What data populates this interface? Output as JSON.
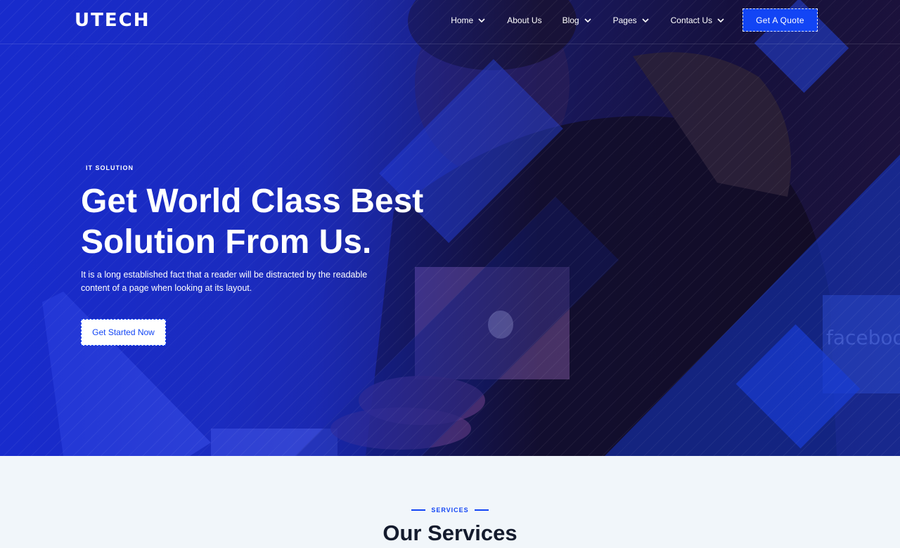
{
  "brand": {
    "logo_text": "UTECH"
  },
  "nav": {
    "items": [
      {
        "label": "Home",
        "has_dropdown": true
      },
      {
        "label": "About Us",
        "has_dropdown": false
      },
      {
        "label": "Blog",
        "has_dropdown": true
      },
      {
        "label": "Pages",
        "has_dropdown": true
      },
      {
        "label": "Contact Us",
        "has_dropdown": true
      }
    ],
    "cta_label": "Get A Quote"
  },
  "hero": {
    "eyebrow": "IT SOLUTION",
    "title_line1": "Get World Class Best",
    "title_line2": "Solution From Us.",
    "description": "It is a long established fact that a reader will be distracted by the readable content of a page when looking at its layout.",
    "cta_label": "Get Started Now",
    "photo_text": "facebook"
  },
  "services": {
    "tag": "SERVICES",
    "title": "Our Services"
  },
  "colors": {
    "accent": "#1245f5",
    "hero_blue": "#1a2fc7",
    "dark_text": "#141b2d",
    "section_bg": "#f1f6fa"
  }
}
